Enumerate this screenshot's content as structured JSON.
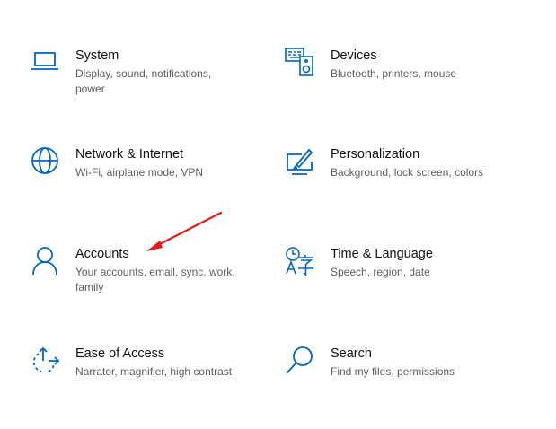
{
  "accent_color": "#0067c0",
  "annotation_color": "#e81a1a",
  "tiles": [
    {
      "icon": "laptop-icon",
      "title": "System",
      "description": "Display, sound, notifications, power"
    },
    {
      "icon": "keyboard-speaker-icon",
      "title": "Devices",
      "description": "Bluetooth, printers, mouse"
    },
    {
      "icon": "globe-icon",
      "title": "Network & Internet",
      "description": "Wi-Fi, airplane mode, VPN"
    },
    {
      "icon": "paint-brush-icon",
      "title": "Personalization",
      "description": "Background, lock screen, colors"
    },
    {
      "icon": "person-icon",
      "title": "Accounts",
      "description": "Your accounts, email, sync, work, family"
    },
    {
      "icon": "time-language-icon",
      "title": "Time & Language",
      "description": "Speech, region, date"
    },
    {
      "icon": "ease-of-access-icon",
      "title": "Ease of Access",
      "description": "Narrator, magnifier, high contrast"
    },
    {
      "icon": "search-icon",
      "title": "Search",
      "description": "Find my files, permissions"
    }
  ]
}
